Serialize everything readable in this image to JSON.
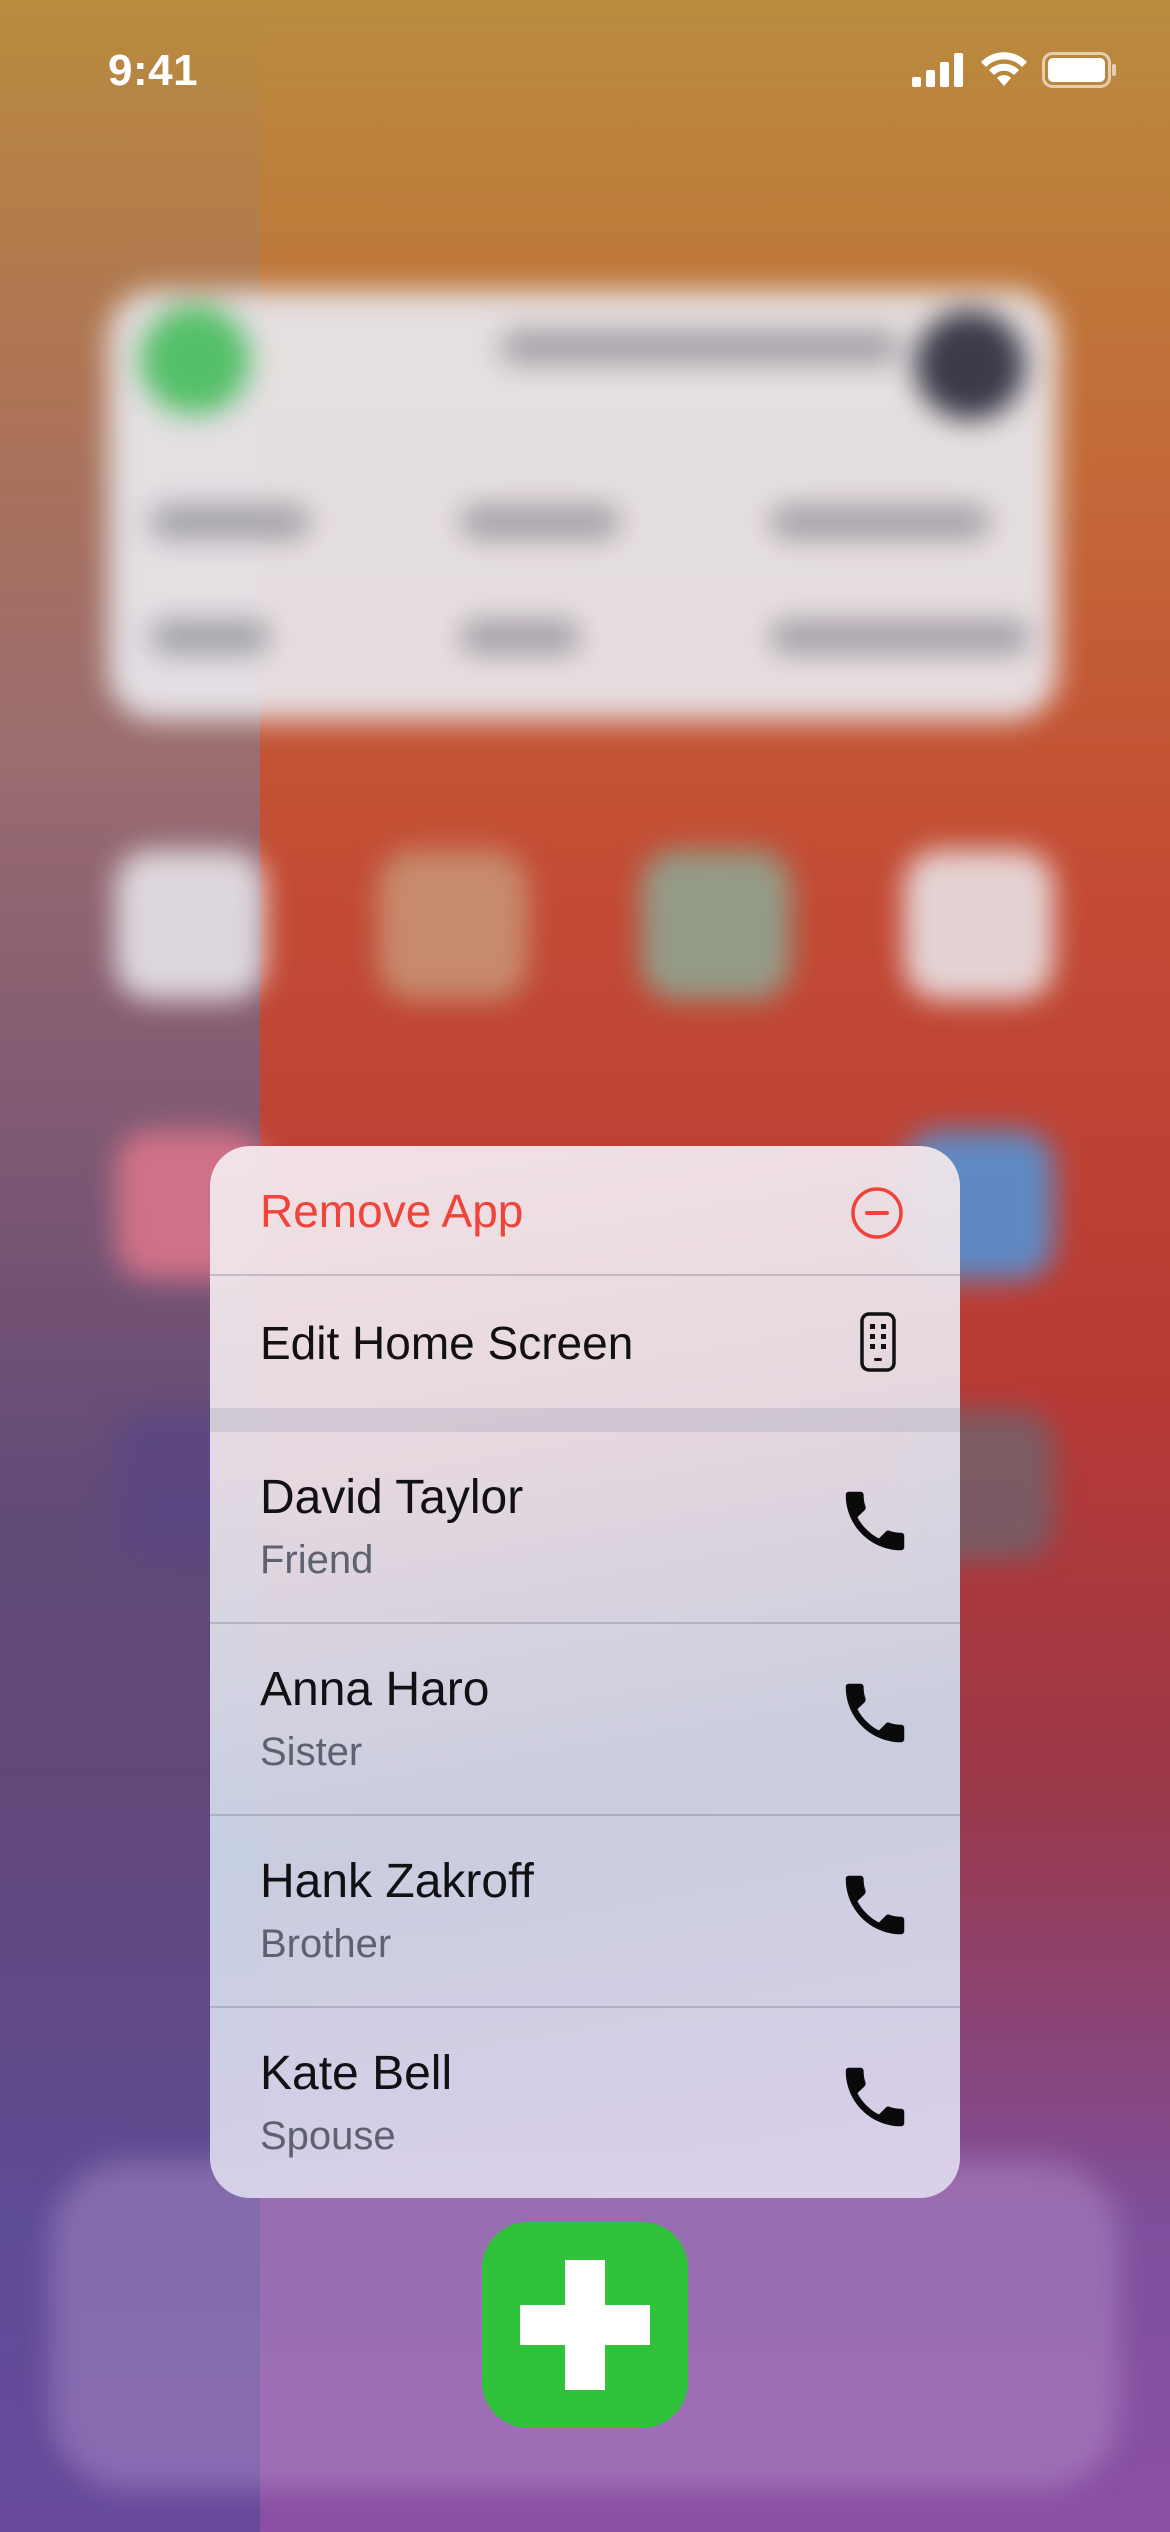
{
  "status_bar": {
    "time": "9:41"
  },
  "menu": {
    "remove_label": "Remove App",
    "edit_label": "Edit Home Screen",
    "contacts": [
      {
        "name": "David Taylor",
        "relation": "Friend"
      },
      {
        "name": "Anna Haro",
        "relation": "Sister"
      },
      {
        "name": "Hank Zakroff",
        "relation": "Brother"
      },
      {
        "name": "Kate Bell",
        "relation": "Spouse"
      }
    ]
  },
  "icons": {
    "remove": "minus-circle-icon",
    "edit": "home-screen-icon",
    "call": "phone-icon",
    "app": "plus-icon"
  },
  "colors": {
    "destructive": "#f0443a",
    "app_icon": "#2fc23a",
    "text_primary": "#111114",
    "text_secondary": "#5e6270"
  }
}
